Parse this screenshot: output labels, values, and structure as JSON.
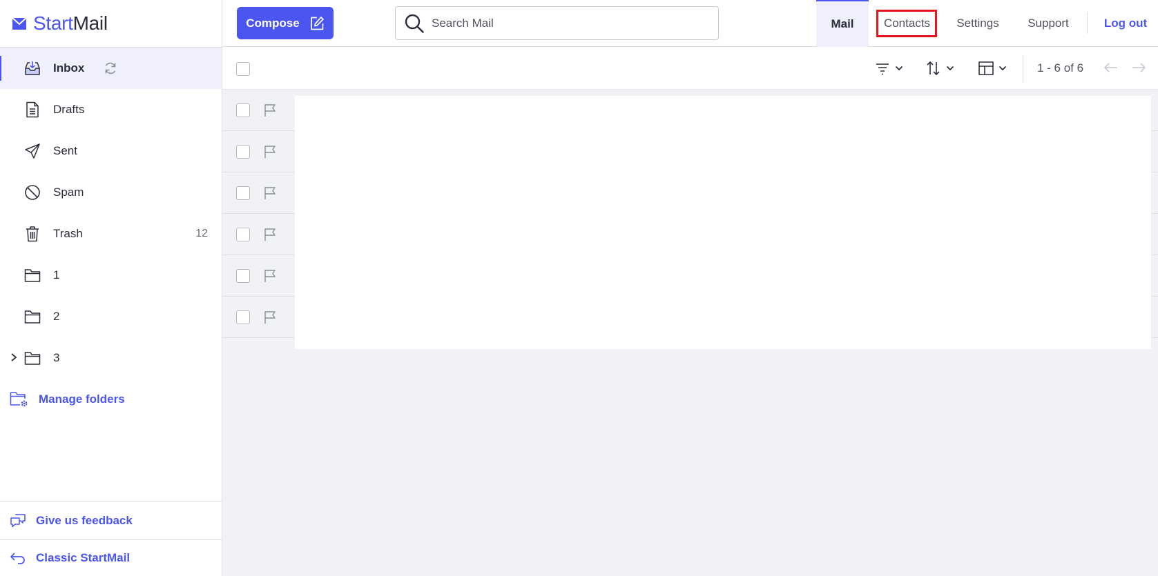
{
  "brand": {
    "start": "Start",
    "mail": "Mail"
  },
  "sidebar": {
    "items": [
      {
        "label": "Inbox",
        "icon": "inbox-icon",
        "count": ""
      },
      {
        "label": "Drafts",
        "icon": "drafts-icon",
        "count": ""
      },
      {
        "label": "Sent",
        "icon": "sent-icon",
        "count": ""
      },
      {
        "label": "Spam",
        "icon": "spam-icon",
        "count": ""
      },
      {
        "label": "Trash",
        "icon": "trash-icon",
        "count": "12"
      },
      {
        "label": "1",
        "icon": "folder-icon",
        "count": ""
      },
      {
        "label": "2",
        "icon": "folder-icon",
        "count": ""
      },
      {
        "label": "3",
        "icon": "folder-icon",
        "count": ""
      }
    ],
    "manage_folders": "Manage folders",
    "feedback": "Give us feedback",
    "classic": "Classic StartMail"
  },
  "header": {
    "compose_label": "Compose",
    "search_placeholder": "Search Mail",
    "nav": {
      "mail": "Mail",
      "contacts": "Contacts",
      "settings": "Settings",
      "support": "Support",
      "logout": "Log out"
    }
  },
  "toolbar": {
    "pagination": "1 - 6 of 6"
  },
  "message_rows": 6,
  "colors": {
    "accent": "#4b55f0",
    "highlight": "#e3141b",
    "background": "#f1f2f6"
  }
}
